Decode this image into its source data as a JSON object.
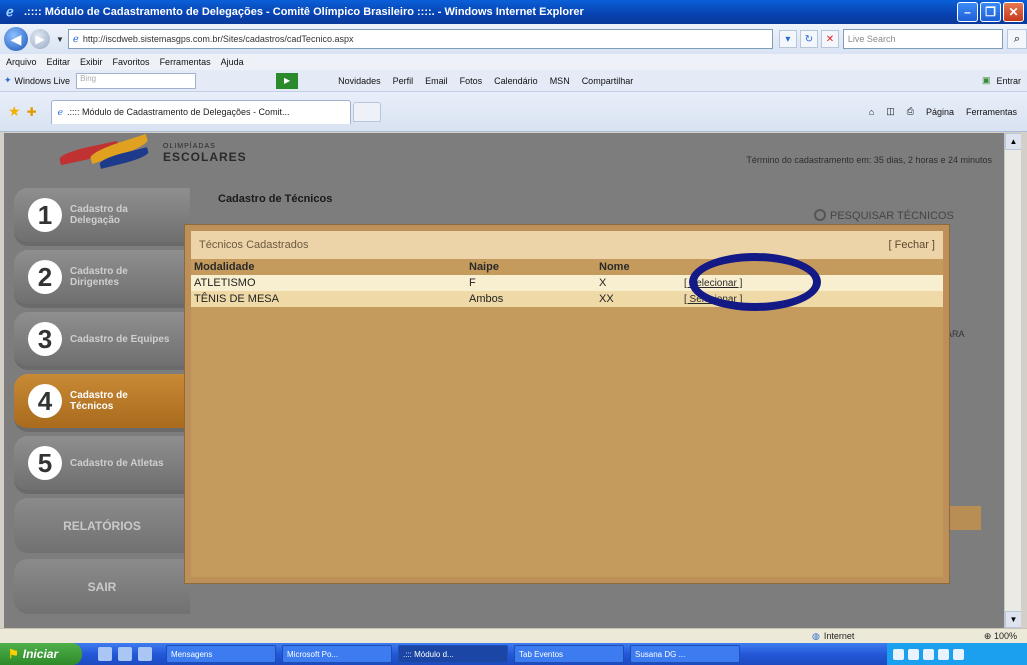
{
  "window": {
    "title": ".:::: Módulo de Cadastramento de Delegações - Comitê Olímpico Brasileiro ::::. - Windows Internet Explorer"
  },
  "address": {
    "url": "http://iscdweb.sistemasgps.com.br/Sites/cadastros/cadTecnico.aspx",
    "search_placeholder": "Live Search"
  },
  "menu": [
    "Arquivo",
    "Editar",
    "Exibir",
    "Favoritos",
    "Ferramentas",
    "Ajuda"
  ],
  "livebar": {
    "label": "Windows Live",
    "search_placeholder": "Bing",
    "links": [
      "Novidades",
      "Perfil",
      "Email",
      "Fotos",
      "Calendário",
      "MSN",
      "Compartilhar"
    ],
    "signin": "Entrar"
  },
  "tab": {
    "title": ".:::: Módulo de Cadastramento de Delegações - Comit...",
    "tools": [
      "Página",
      "Ferramentas"
    ]
  },
  "page": {
    "logo_small": "OLIMPÍADAS",
    "logo_big": "ESCOLARES",
    "deadline": "Término do cadastramento em: 35 dias, 2 horas e 24 minutos",
    "section_title": "Cadastro de Técnicos",
    "search_link": "PESQUISAR TÉCNICOS",
    "behind_text": "ARA"
  },
  "sidenav": {
    "items": [
      {
        "num": "1",
        "label": "Cadastro da Delegação"
      },
      {
        "num": "2",
        "label": "Cadastro de Dirigentes"
      },
      {
        "num": "3",
        "label": "Cadastro de Equipes"
      },
      {
        "num": "4",
        "label": "Cadastro de Técnicos"
      },
      {
        "num": "5",
        "label": "Cadastro de Atletas"
      }
    ],
    "reports": "RELATÓRIOS",
    "exit": "SAIR"
  },
  "modal": {
    "title": "Técnicos Cadastrados",
    "close": "[ Fechar ]",
    "columns": [
      "Modalidade",
      "Naipe",
      "Nome"
    ],
    "rows": [
      {
        "modalidade": "ATLETISMO",
        "naipe": "F",
        "nome": "X",
        "action": "[ Selecionar ]"
      },
      {
        "modalidade": "TÊNIS DE MESA",
        "naipe": "Ambos",
        "nome": "XX",
        "action": "[ Selecionar ]"
      }
    ]
  },
  "status": {
    "zone": "Internet",
    "zoom": "100%"
  },
  "taskbar": {
    "start": "Iniciar",
    "buttons": [
      "Mensagens",
      "Microsoft Po...",
      ".::: Módulo d...",
      "Tab Eventos",
      "Susana DG ..."
    ]
  },
  "colors": {
    "modal_bg": "#c59a5d",
    "modal_header": "#ecd3a8",
    "active_nav": "#c88a35",
    "ring": "#141a85"
  }
}
